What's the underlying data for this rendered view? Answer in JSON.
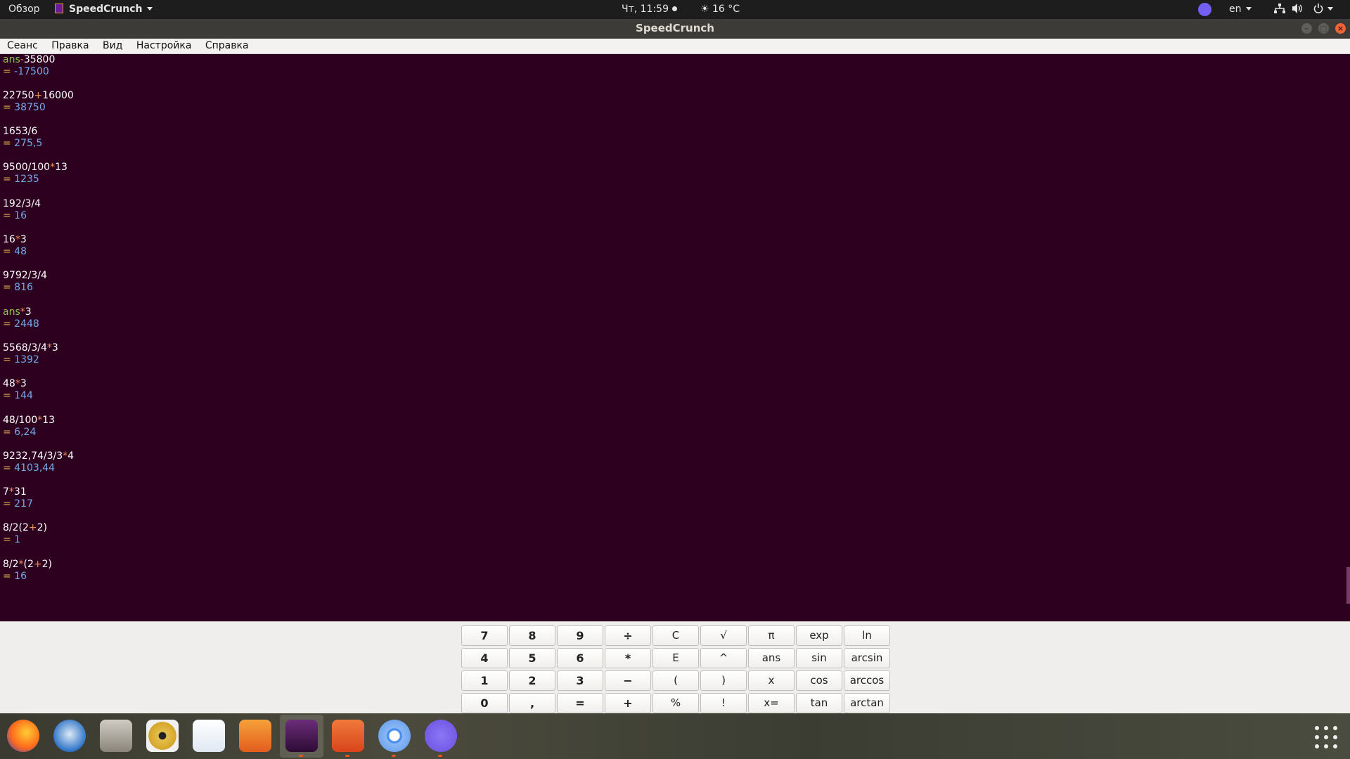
{
  "topbar": {
    "overview": "Обзор",
    "app_menu": "SpeedCrunch",
    "clock": "Чт, 11:59",
    "weather": "☀ 16 °C",
    "lang": "en"
  },
  "window": {
    "title": "SpeedCrunch"
  },
  "menubar": {
    "items": [
      "Сеанс",
      "Правка",
      "Вид",
      "Настройка",
      "Справка"
    ]
  },
  "history": [
    {
      "expr": "ans-35800",
      "result": " -17500"
    },
    {
      "expr": "22750+16000",
      "result": " 38750"
    },
    {
      "expr": "1653/6",
      "result": " 275,5"
    },
    {
      "expr": "9500/100*13",
      "result": " 1235"
    },
    {
      "expr": "192/3/4",
      "result": " 16"
    },
    {
      "expr": "16*3",
      "result": " 48"
    },
    {
      "expr": "9792/3/4",
      "result": " 816"
    },
    {
      "expr": "ans*3",
      "result": " 2448"
    },
    {
      "expr": "5568/3/4*3",
      "result": " 1392"
    },
    {
      "expr": "48*3",
      "result": " 144"
    },
    {
      "expr": "48/100*13",
      "result": " 6,24"
    },
    {
      "expr": "9232,74/3/3*4",
      "result": " 4103,44"
    },
    {
      "expr": "7*31",
      "result": " 217"
    },
    {
      "expr": "8/2(2+2)",
      "result": " 1"
    },
    {
      "expr": "8/2*(2+2)",
      "result": " 16"
    }
  ],
  "input": {
    "value": ""
  },
  "keypad": {
    "rows": [
      [
        "7",
        "8",
        "9",
        "÷",
        "C",
        "√",
        "π",
        "exp",
        "ln"
      ],
      [
        "4",
        "5",
        "6",
        "*",
        "E",
        "^",
        "ans",
        "sin",
        "arcsin"
      ],
      [
        "1",
        "2",
        "3",
        "−",
        "(",
        ")",
        "x",
        "cos",
        "arccos"
      ],
      [
        "0",
        ",",
        "=",
        "+",
        "%",
        "!",
        "x=",
        "tan",
        "arctan"
      ]
    ]
  },
  "colors": {
    "display_bg": "#2c001e",
    "expr": "#ffffff",
    "result": "#77a8ea",
    "equals": "#e0b04a",
    "keyword": "#8fc44a",
    "operator": "#f08c5a"
  },
  "dock": {
    "apps": [
      {
        "icon": "firefox-icon",
        "running": false
      },
      {
        "icon": "thunderbird-icon",
        "running": false
      },
      {
        "icon": "files-icon",
        "running": false
      },
      {
        "icon": "rhythmbox-icon",
        "running": false
      },
      {
        "icon": "libreoffice-writer-icon",
        "running": false
      },
      {
        "icon": "ubuntu-software-icon",
        "running": false
      },
      {
        "icon": "speedcrunch-icon",
        "running": true
      },
      {
        "icon": "software-updater-icon",
        "running": true
      },
      {
        "icon": "chromium-icon",
        "running": true
      },
      {
        "icon": "viber-icon",
        "running": true
      }
    ]
  }
}
